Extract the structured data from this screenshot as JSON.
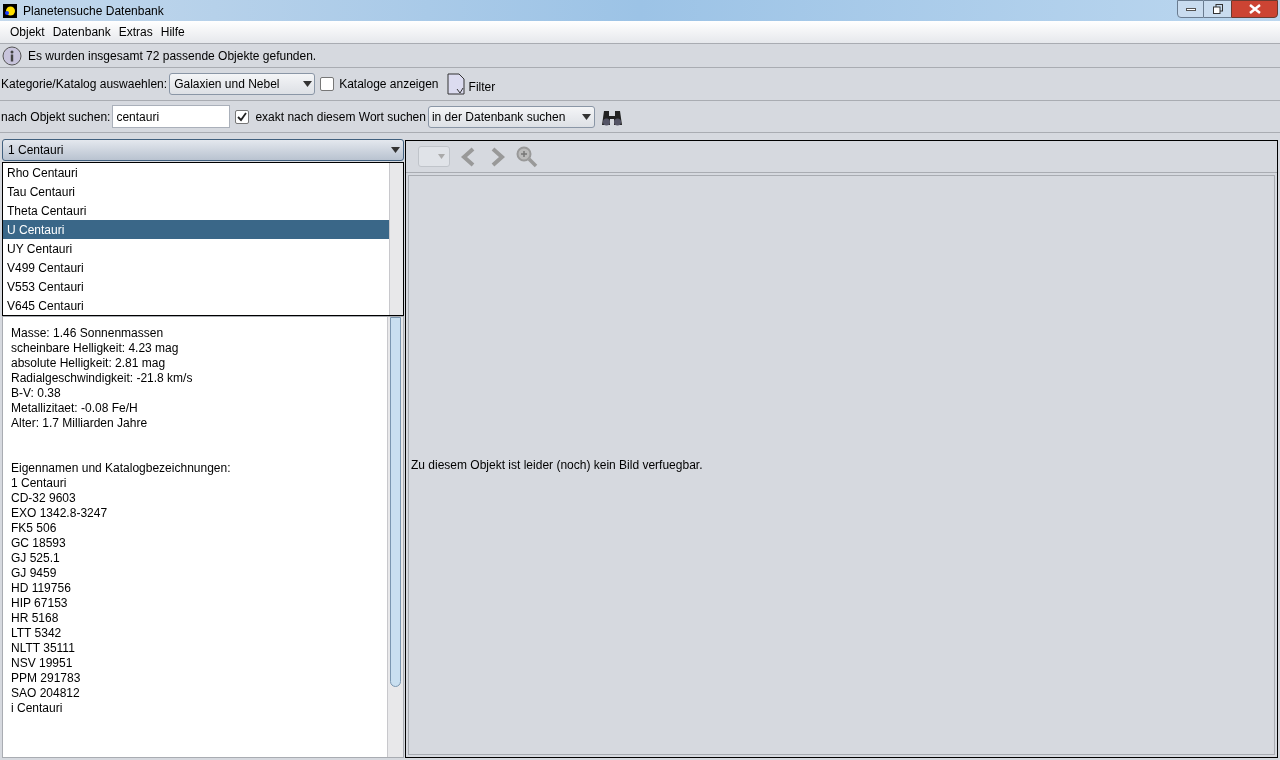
{
  "window": {
    "title": "Planetensuche Datenbank"
  },
  "menu": [
    "Objekt",
    "Datenbank",
    "Extras",
    "Hilfe"
  ],
  "info": "Es wurden insgesamt 72 passende Objekte gefunden.",
  "category": {
    "label": "Kategorie/Katalog auswaehlen:",
    "value": "Galaxien und Nebel",
    "show_catalogs": {
      "label": "Kataloge anzeigen",
      "checked": false
    },
    "filter": "Filter"
  },
  "search": {
    "label": "nach Objekt suchen:",
    "value": "centauri",
    "exact": {
      "label": "exakt nach diesem Wort suchen",
      "checked": true
    },
    "scope": "in der Datenbank suchen"
  },
  "object_combo": {
    "value": "1 Centauri"
  },
  "object_list": [
    {
      "name": "Rho Centauri",
      "selected": false
    },
    {
      "name": "Tau Centauri",
      "selected": false
    },
    {
      "name": "Theta Centauri",
      "selected": false
    },
    {
      "name": "U Centauri",
      "selected": true
    },
    {
      "name": "UY Centauri",
      "selected": false
    },
    {
      "name": "V499 Centauri",
      "selected": false
    },
    {
      "name": "V553 Centauri",
      "selected": false
    },
    {
      "name": "V645 Centauri",
      "selected": false
    }
  ],
  "details": [
    "Masse: 1.46 Sonnenmassen",
    "scheinbare Helligkeit: 4.23 mag",
    "absolute Helligkeit: 2.81 mag",
    "Radialgeschwindigkeit: -21.8 km/s",
    "B-V: 0.38",
    "Metallizitaet: -0.08 Fe/H",
    "Alter: 1.7 Milliarden Jahre"
  ],
  "names_heading": "Eigennamen und Katalogbezeichnungen:",
  "names": [
    "1 Centauri",
    "CD-32 9603",
    "EXO 1342.8-3247",
    "FK5 506",
    "GC 18593",
    "GJ 525.1",
    "GJ 9459",
    "HD 119756",
    "HIP 67153",
    "HR 5168",
    "LTT 5342",
    "NLTT 35111",
    "NSV 19951",
    "PPM 291783",
    "SAO 204812",
    "i Centauri"
  ],
  "image_message": "Zu diesem Objekt ist leider (noch) kein Bild verfuegbar."
}
